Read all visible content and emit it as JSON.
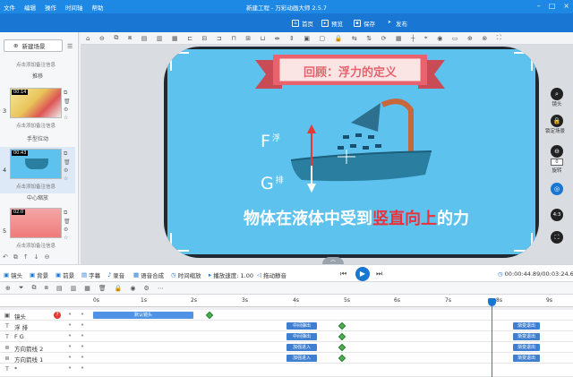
{
  "titlebar": {
    "menu": [
      "文件",
      "编辑",
      "操作",
      "时间轴",
      "帮助"
    ],
    "title": "新建工程 - 万彩动画大师 2.5.7"
  },
  "actionbar": {
    "home": "首页",
    "preview": "预览",
    "save": "保存",
    "publish": "发布"
  },
  "leftpanel": {
    "new_scene": "新建场景",
    "scenes": [
      {
        "note": "点击添加备注信息",
        "name": "推移"
      },
      {
        "num": "3",
        "badge": "00:14",
        "note": "点击添加备注信息",
        "name": "手型拉动"
      },
      {
        "num": "4",
        "badge": "00:43",
        "note": "点击添加备注信息",
        "name": "中心缩放"
      },
      {
        "num": "5",
        "badge": "02:0",
        "note": "点击添加备注信息",
        "name": ""
      }
    ]
  },
  "slide": {
    "banner": "回顾：浮力的定义",
    "f_float": "F",
    "f_float_sub": "浮",
    "g_discharge": "G",
    "g_discharge_sub": "排",
    "caption_pre": "物体在液体中受到",
    "caption_hl": "竖直向上",
    "caption_post": "的力"
  },
  "righttools": {
    "camera": "镜头",
    "lock": "锁定场景",
    "rotate": "旋转",
    "rotate_val": "0",
    "ratio": "4:3"
  },
  "playbar": {
    "items": [
      "镜头",
      "背景",
      "前景",
      "字幕",
      "录音",
      "语音合成",
      "时间缩放",
      "播放速度: 1.00",
      "拖动静音"
    ],
    "time": "00:00:44.89/00:03:24.60"
  },
  "ruler": {
    "ticks": [
      "0s",
      "1s",
      "2s",
      "3s",
      "4s",
      "5s",
      "6s",
      "7s",
      "8s",
      "9s"
    ]
  },
  "tracks": [
    {
      "icon": "▣",
      "name": "镜头",
      "clips": [
        {
          "label": "默认镜头"
        }
      ]
    },
    {
      "icon": "T",
      "name": "浮 排",
      "clips": [
        {
          "label": "中间弹出"
        },
        {
          "label": "渐变退出"
        }
      ]
    },
    {
      "icon": "T",
      "name": "F G",
      "clips": [
        {
          "label": "中间弹出"
        },
        {
          "label": "渐变退出"
        }
      ]
    },
    {
      "icon": "⊛",
      "name": "方向箭线 2",
      "clips": [
        {
          "label": "加强进入"
        },
        {
          "label": "渐变退出"
        }
      ]
    },
    {
      "icon": "⊛",
      "name": "方向箭线 1",
      "clips": [
        {
          "label": "加强进入"
        },
        {
          "label": "渐变退出"
        }
      ]
    },
    {
      "icon": "T",
      "name": "*",
      "clips": []
    }
  ],
  "colors": {
    "accent": "#1976d2",
    "stage": "#5ec2ee",
    "banner": "#e8636d",
    "highlight": "#e8333c"
  }
}
